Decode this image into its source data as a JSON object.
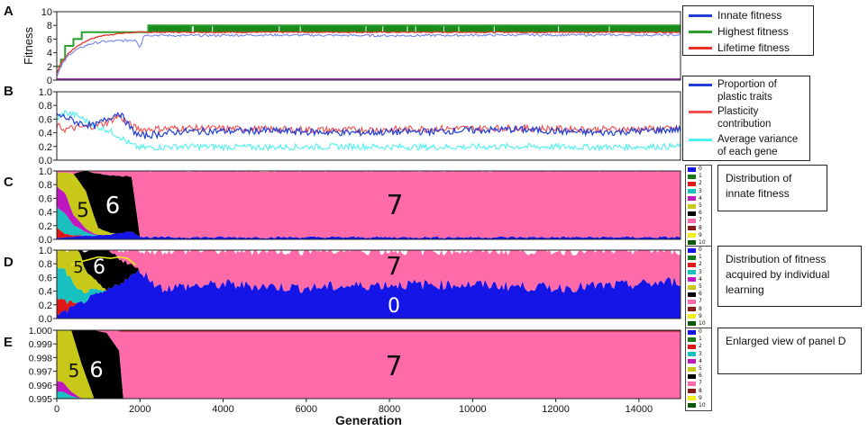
{
  "figure": {
    "xlabel": "Generation",
    "x_ticks": [
      0,
      2000,
      4000,
      6000,
      8000,
      10000,
      12000,
      14000
    ]
  },
  "panels": {
    "A": {
      "letter": "A",
      "ylabel": "Fitness",
      "y_ticks": [
        0,
        2,
        4,
        6,
        8,
        10
      ],
      "legend": [
        {
          "label": "Innate fitness",
          "color": "#1f3fd8"
        },
        {
          "label": "Highest fitness",
          "color": "#2aa02a"
        },
        {
          "label": "Lifetime fitness",
          "color": "#e8332a"
        }
      ]
    },
    "B": {
      "letter": "B",
      "y_ticks": [
        "0.0",
        "0.2",
        "0.4",
        "0.6",
        "0.8",
        "1.0"
      ],
      "legend": [
        {
          "label": "Proportion of plastic traits",
          "color": "#1f3fd8"
        },
        {
          "label": "Plasticity contribution",
          "color": "#f05050"
        },
        {
          "label": "Average variance of each gene",
          "color": "#4ff0f0"
        }
      ]
    },
    "C": {
      "letter": "C",
      "y_ticks": [
        "0.0",
        "0.2",
        "0.4",
        "0.6",
        "0.8",
        "1.0"
      ],
      "labels": [
        "5",
        "6",
        "7"
      ],
      "note": "Distribution of innate fitness"
    },
    "D": {
      "letter": "D",
      "y_ticks": [
        "0.0",
        "0.2",
        "0.4",
        "0.6",
        "0.8",
        "1.0"
      ],
      "labels": [
        "5",
        "6",
        "7",
        "0"
      ],
      "note": "Distribution of fitness acquired by individual learning"
    },
    "E": {
      "letter": "E",
      "y_ticks": [
        "0.995",
        "0.996",
        "0.997",
        "0.998",
        "0.999",
        "1.000"
      ],
      "labels": [
        "5",
        "6",
        "7"
      ],
      "note": "Enlarged view of panel D"
    }
  },
  "fitness_key": [
    {
      "label": "0",
      "color": "#1515e8"
    },
    {
      "label": "1",
      "color": "#1a7a1a"
    },
    {
      "label": "2",
      "color": "#e01515"
    },
    {
      "label": "3",
      "color": "#18c0c0"
    },
    {
      "label": "4",
      "color": "#c018c0"
    },
    {
      "label": "5",
      "color": "#c8c818"
    },
    {
      "label": "6",
      "color": "#000000"
    },
    {
      "label": "7",
      "color": "#ff6aa8"
    },
    {
      "label": "8",
      "color": "#8b1a1a"
    },
    {
      "label": "9",
      "color": "#f0f018"
    },
    {
      "label": "10",
      "color": "#0a5a0a"
    }
  ],
  "chart_data": [
    {
      "type": "line",
      "panel": "A",
      "ylabel": "Fitness",
      "xlabel": "Generation",
      "xlim": [
        0,
        15000
      ],
      "ylim": [
        0,
        10
      ],
      "series": [
        {
          "name": "Innate fitness",
          "x": [
            0,
            100,
            300,
            500,
            800,
            1100,
            1400,
            1700,
            1900,
            2000,
            2100,
            3000,
            5000,
            8000,
            11000,
            15000
          ],
          "values": [
            0.6,
            2.0,
            3.8,
            4.5,
            5.3,
            5.6,
            5.7,
            5.8,
            5.9,
            4.8,
            6.6,
            6.5,
            6.6,
            6.5,
            6.6,
            6.6
          ]
        },
        {
          "name": "Highest fitness",
          "x": [
            0,
            100,
            200,
            400,
            600,
            900,
            1300,
            1800,
            2200,
            15000
          ],
          "values": [
            2,
            3,
            5,
            6,
            7,
            7,
            7,
            7,
            8,
            8
          ]
        },
        {
          "name": "Lifetime fitness",
          "x": [
            0,
            100,
            300,
            500,
            800,
            1100,
            1500,
            1900,
            2200,
            15000
          ],
          "values": [
            1,
            2.5,
            4,
            5,
            6,
            6.5,
            6.8,
            7,
            7,
            7
          ]
        }
      ]
    },
    {
      "type": "line",
      "panel": "B",
      "xlim": [
        0,
        15000
      ],
      "ylim": [
        0,
        1
      ],
      "series": [
        {
          "name": "Proportion of plastic traits",
          "x": [
            0,
            200,
            500,
            900,
            1200,
            1500,
            1800,
            2000,
            3000,
            5000,
            7000,
            9000,
            11000,
            13000,
            15000
          ],
          "values": [
            0.66,
            0.63,
            0.55,
            0.5,
            0.6,
            0.7,
            0.45,
            0.35,
            0.42,
            0.43,
            0.4,
            0.42,
            0.45,
            0.4,
            0.45
          ]
        },
        {
          "name": "Plasticity contribution",
          "x": [
            0,
            200,
            500,
            900,
            1200,
            1500,
            1800,
            2000,
            3000,
            5000,
            7000,
            9000,
            11000,
            13000,
            15000
          ],
          "values": [
            0.5,
            0.45,
            0.48,
            0.5,
            0.55,
            0.65,
            0.5,
            0.45,
            0.47,
            0.45,
            0.44,
            0.46,
            0.47,
            0.45,
            0.46
          ]
        },
        {
          "name": "Average variance of each gene",
          "x": [
            0,
            200,
            500,
            900,
            1200,
            1500,
            1800,
            2000,
            3000,
            5000,
            7000,
            9000,
            11000,
            13000,
            15000
          ],
          "values": [
            0.6,
            0.7,
            0.65,
            0.5,
            0.45,
            0.35,
            0.22,
            0.18,
            0.2,
            0.19,
            0.2,
            0.19,
            0.2,
            0.19,
            0.2
          ]
        }
      ]
    },
    {
      "type": "area",
      "panel": "C",
      "stacked": true,
      "xlim": [
        0,
        15000
      ],
      "ylim": [
        0,
        1
      ],
      "x": [
        0,
        200,
        400,
        700,
        1000,
        1400,
        1800,
        2000,
        2200,
        15000
      ],
      "series": [
        {
          "name": "0",
          "values": [
            0.02,
            0.03,
            0.04,
            0.05,
            0.06,
            0.08,
            0.12,
            0.04,
            0.03,
            0.03
          ]
        },
        {
          "name": "2",
          "values": [
            0.15,
            0.05,
            0.02,
            0.0,
            0.0,
            0.0,
            0.0,
            0.0,
            0.0,
            0.0
          ]
        },
        {
          "name": "3",
          "values": [
            0.3,
            0.3,
            0.15,
            0.05,
            0.0,
            0.0,
            0.0,
            0.0,
            0.0,
            0.0
          ]
        },
        {
          "name": "4",
          "values": [
            0.3,
            0.3,
            0.15,
            0.05,
            0.0,
            0.0,
            0.0,
            0.0,
            0.0,
            0.0
          ]
        },
        {
          "name": "5",
          "values": [
            0.2,
            0.3,
            0.6,
            0.55,
            0.1,
            0.0,
            0.0,
            0.0,
            0.0,
            0.0
          ]
        },
        {
          "name": "6",
          "values": [
            0.0,
            0.0,
            0.0,
            0.3,
            0.8,
            0.85,
            0.8,
            0.0,
            0.0,
            0.0
          ]
        },
        {
          "name": "7",
          "values": [
            0.03,
            0.02,
            0.04,
            0.05,
            0.04,
            0.07,
            0.08,
            0.96,
            0.97,
            0.97
          ]
        }
      ]
    },
    {
      "type": "area",
      "panel": "D",
      "stacked": true,
      "xlim": [
        0,
        15000
      ],
      "ylim": [
        0,
        1
      ],
      "x": [
        0,
        200,
        500,
        800,
        1200,
        1600,
        2000,
        2500,
        4000,
        6000,
        8000,
        10000,
        12000,
        14000,
        15000
      ],
      "series": [
        {
          "name": "0",
          "values": [
            0.05,
            0.1,
            0.2,
            0.3,
            0.4,
            0.55,
            0.7,
            0.45,
            0.5,
            0.45,
            0.5,
            0.5,
            0.45,
            0.5,
            0.55
          ]
        },
        {
          "name": "2",
          "values": [
            0.25,
            0.15,
            0.0,
            0.0,
            0.0,
            0.0,
            0.0,
            0.0,
            0.0,
            0.0,
            0.0,
            0.0,
            0.0,
            0.0,
            0.0
          ]
        },
        {
          "name": "3",
          "values": [
            0.45,
            0.45,
            0.2,
            0.1,
            0.0,
            0.0,
            0.0,
            0.0,
            0.0,
            0.0,
            0.0,
            0.0,
            0.0,
            0.0,
            0.0
          ]
        },
        {
          "name": "5",
          "values": [
            0.25,
            0.3,
            0.6,
            0.2,
            0.0,
            0.0,
            0.0,
            0.0,
            0.0,
            0.0,
            0.0,
            0.0,
            0.0,
            0.0,
            0.0
          ]
        },
        {
          "name": "6",
          "values": [
            0.0,
            0.0,
            0.0,
            0.4,
            0.6,
            0.3,
            0.0,
            0.0,
            0.0,
            0.0,
            0.0,
            0.0,
            0.0,
            0.0,
            0.0
          ]
        },
        {
          "name": "7",
          "values": [
            0.0,
            0.0,
            0.0,
            0.0,
            0.0,
            0.15,
            0.3,
            0.55,
            0.5,
            0.55,
            0.5,
            0.5,
            0.55,
            0.5,
            0.45
          ]
        }
      ]
    },
    {
      "type": "area",
      "panel": "E",
      "stacked": true,
      "xlim": [
        0,
        15000
      ],
      "ylim": [
        0.995,
        1.0
      ],
      "x": [
        0,
        150,
        350,
        600,
        900,
        1200,
        1500,
        1600,
        15000
      ],
      "series": [
        {
          "name": "3",
          "values": [
            0.9955,
            0.9955,
            0.9952,
            0.995,
            0.995,
            0.995,
            0.995,
            0.995,
            0.995
          ]
        },
        {
          "name": "4",
          "values": [
            0.9963,
            0.9962,
            0.9955,
            0.995,
            0.995,
            0.995,
            0.995,
            0.995,
            0.995
          ]
        },
        {
          "name": "5",
          "values": [
            1.0,
            1.0,
            1.0,
            0.9975,
            0.995,
            0.995,
            0.995,
            0.995,
            0.995
          ]
        },
        {
          "name": "6",
          "values": [
            1.0,
            1.0,
            1.0,
            1.0,
            1.0,
            0.9998,
            0.9985,
            0.995,
            0.995
          ]
        },
        {
          "name": "7",
          "values": [
            1.0,
            1.0,
            1.0,
            1.0,
            1.0,
            1.0,
            1.0,
            1.0,
            1.0
          ]
        }
      ]
    }
  ]
}
